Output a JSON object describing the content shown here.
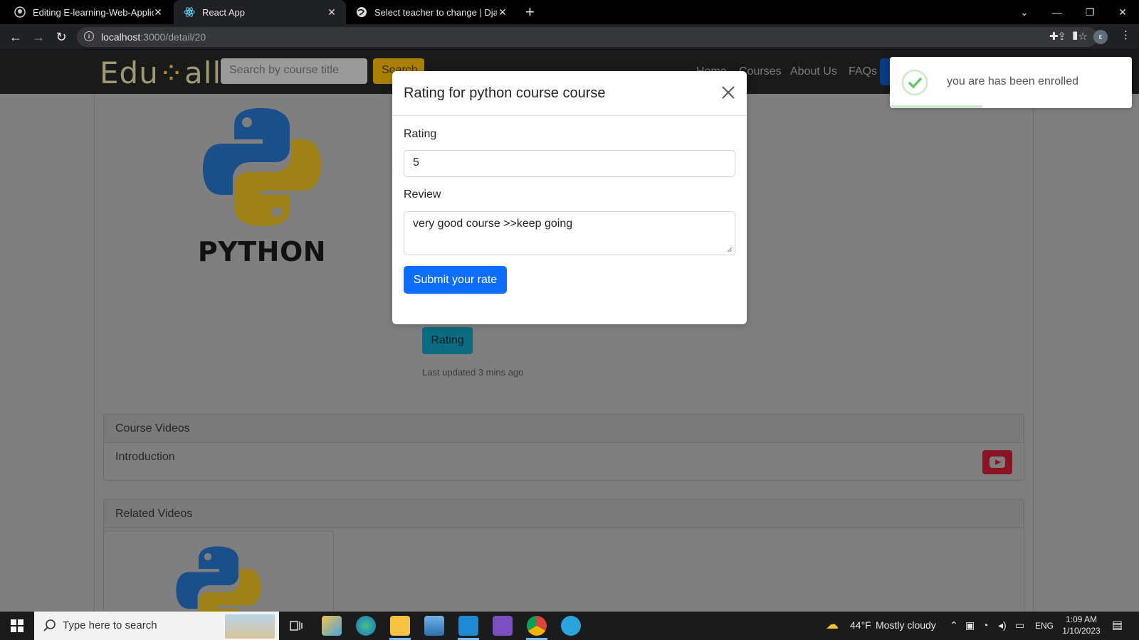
{
  "browser": {
    "tabs": [
      {
        "title": "Editing E-learning-Web-Applicati",
        "icon": "github-icon"
      },
      {
        "title": "React App",
        "icon": "react-icon"
      },
      {
        "title": "Select teacher to change | Djang",
        "icon": "globe-icon"
      }
    ],
    "url_host": "localhost",
    "url_path": ":3000/detail/20",
    "profile_initial": "ε"
  },
  "site": {
    "logo_left": "Edu",
    "logo_mid": "⁘",
    "logo_right": "all",
    "search_placeholder": "Search by course title",
    "search_button": "Search",
    "nav": [
      "Home",
      "Courses",
      "About Us",
      "FAQs"
    ]
  },
  "course": {
    "logo_text": "PYTHON",
    "rating_button": "Rating",
    "last_updated": "Last updated 3 mins ago"
  },
  "course_videos": {
    "header": "Course Videos",
    "items": [
      {
        "title": "Introduction"
      }
    ]
  },
  "related_videos": {
    "header": "Related Videos"
  },
  "modal": {
    "title": "Rating for python course course",
    "rating_label": "Rating",
    "rating_value": "5",
    "review_label": "Review",
    "review_value": "very good course >>keep going",
    "submit_label": "Submit your rate"
  },
  "toast": {
    "message": "you are has been enrolled"
  },
  "taskbar": {
    "search_placeholder": "Type here to search",
    "weather_temp": "44°F",
    "weather_desc": "Mostly cloudy",
    "language": "ENG",
    "time": "1:09 AM",
    "date": "1/10/2023"
  },
  "colors": {
    "brand_primary": "#0d6efd",
    "rating_info": "#0dcaf0",
    "toast_success": "#07bc0c"
  }
}
